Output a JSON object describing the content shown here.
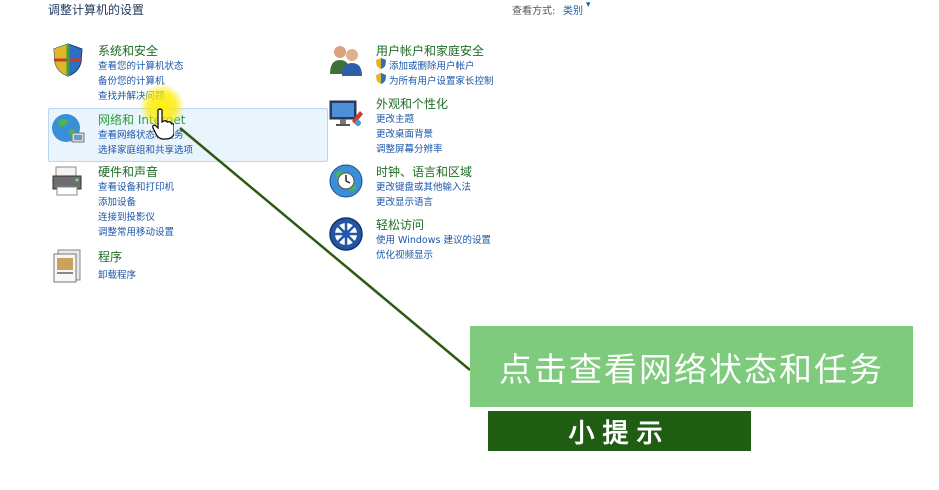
{
  "header": {
    "title": "调整计算机的设置",
    "view_mode_label": "查看方式:",
    "view_mode_value": "类别"
  },
  "categories_left": [
    {
      "title": "系统和安全",
      "icon": "security-shield-icon",
      "links": [
        "查看您的计算机状态",
        "备份您的计算机",
        "查找并解决问题"
      ]
    },
    {
      "title": "网络和 Internet",
      "icon": "network-globe-icon",
      "links": [
        "查看网络状态和任务",
        "选择家庭组和共享选项"
      ],
      "highlighted": true
    },
    {
      "title": "硬件和声音",
      "icon": "printer-icon",
      "links": [
        "查看设备和打印机",
        "添加设备",
        "连接到投影仪",
        "调整常用移动设置"
      ]
    },
    {
      "title": "程序",
      "icon": "programs-icon",
      "links": [
        "卸载程序"
      ]
    }
  ],
  "categories_right": [
    {
      "title": "用户帐户和家庭安全",
      "icon": "users-icon",
      "links": [
        "添加或删除用户帐户",
        "为所有用户设置家长控制"
      ]
    },
    {
      "title": "外观和个性化",
      "icon": "display-icon",
      "links": [
        "更改主题",
        "更改桌面背景",
        "调整屏幕分辨率"
      ]
    },
    {
      "title": "时钟、语言和区域",
      "icon": "clock-globe-icon",
      "links": [
        "更改键盘或其他输入法",
        "更改显示语言"
      ]
    },
    {
      "title": "轻松访问",
      "icon": "ease-of-access-icon",
      "links": [
        "使用 Windows 建议的设置",
        "优化视频显示"
      ]
    }
  ],
  "tip": {
    "message": "点击查看网络状态和任务",
    "badge": "小提示"
  },
  "colors": {
    "heading_green": "#1e6b24",
    "link_blue": "#1a56a8",
    "tip_green": "#7ecb7e",
    "badge_dark_green": "#1f5e12",
    "highlight_bg": "#eaf4fc"
  }
}
